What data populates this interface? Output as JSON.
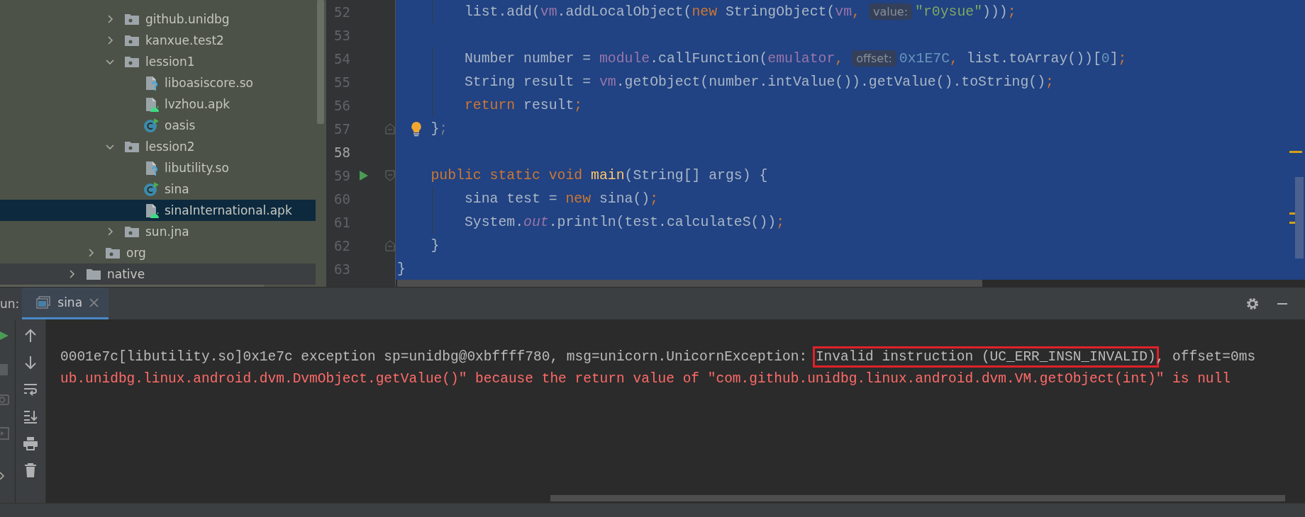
{
  "tree": {
    "items": [
      {
        "children": [
          {
            "children": [
              {
                "label": "github.unidbg",
                "kind": "package",
                "expanded": false,
                "selected": false
              },
              {
                "label": "kanxue.test2",
                "kind": "package",
                "expanded": false,
                "selected": false
              },
              {
                "label": "lession1",
                "kind": "package",
                "expanded": true,
                "selected": false,
                "children": [
                  {
                    "label": "liboasiscore.so",
                    "kind": "so",
                    "selected": false
                  },
                  {
                    "label": "lvzhou.apk",
                    "kind": "apk",
                    "selected": false
                  },
                  {
                    "label": "oasis",
                    "kind": "class",
                    "selected": false
                  }
                ]
              },
              {
                "label": "lession2",
                "kind": "package",
                "expanded": true,
                "selected": false,
                "children": [
                  {
                    "label": "libutility.so",
                    "kind": "so",
                    "selected": false
                  },
                  {
                    "label": "sina",
                    "kind": "class",
                    "selected": false
                  },
                  {
                    "label": "sinaInternational.apk",
                    "kind": "apk",
                    "selected": true
                  }
                ]
              },
              {
                "label": "sun.jna",
                "kind": "package",
                "expanded": false,
                "selected": false
              }
            ]
          },
          {
            "label": "org",
            "kind": "package",
            "expanded": false,
            "selected": false
          }
        ]
      },
      {
        "label": "native",
        "kind": "folder",
        "expanded": false,
        "selected": false
      }
    ]
  },
  "editor": {
    "lines": [
      {
        "number": "52",
        "current": false,
        "run": false,
        "bulb": false,
        "tokens": [
          {
            "text": "        list.add(",
            "kind": "plain"
          },
          {
            "text": "vm",
            "kind": "field"
          },
          {
            "text": ".addLocalObject(",
            "kind": "plain"
          },
          {
            "text": "new",
            "kind": "kw"
          },
          {
            "text": " StringObject(",
            "kind": "plain"
          },
          {
            "text": "vm",
            "kind": "field"
          },
          {
            "text": ",",
            "kind": "punct"
          },
          {
            "text": "value:",
            "kind": "hint"
          },
          {
            "text": "\"r0ysue\"",
            "kind": "str"
          },
          {
            "text": ")))",
            "kind": "plain"
          },
          {
            "text": ";",
            "kind": "punct"
          }
        ]
      },
      {
        "number": "53",
        "current": false,
        "run": false,
        "bulb": false
      },
      {
        "number": "54",
        "current": false,
        "run": false,
        "bulb": false,
        "tokens": [
          {
            "text": "        Number number = ",
            "kind": "plain"
          },
          {
            "text": "module",
            "kind": "field"
          },
          {
            "text": ".callFunction(",
            "kind": "plain"
          },
          {
            "text": "emulator",
            "kind": "field"
          },
          {
            "text": ",",
            "kind": "punct"
          },
          {
            "text": "offset:",
            "kind": "hint"
          },
          {
            "text": "0x1E7C",
            "kind": "num"
          },
          {
            "text": ",",
            "kind": "punct"
          },
          {
            "text": " list.toArray())[",
            "kind": "plain"
          },
          {
            "text": "0",
            "kind": "num"
          },
          {
            "text": "]",
            "kind": "plain"
          },
          {
            "text": ";",
            "kind": "punct"
          }
        ]
      },
      {
        "number": "55",
        "current": false,
        "run": false,
        "bulb": false,
        "tokens": [
          {
            "text": "        String result = ",
            "kind": "plain"
          },
          {
            "text": "vm",
            "kind": "field"
          },
          {
            "text": ".getObject(number.intValue()).getValue().toString()",
            "kind": "plain"
          },
          {
            "text": ";",
            "kind": "punct"
          }
        ]
      },
      {
        "number": "56",
        "current": false,
        "run": false,
        "bulb": false,
        "tokens": [
          {
            "text": "        return",
            "kind": "kw"
          },
          {
            "text": " result",
            "kind": "plain"
          },
          {
            "text": ";",
            "kind": "punct"
          }
        ]
      },
      {
        "number": "57",
        "current": false,
        "run": false,
        "bulb": true,
        "fold_start": false,
        "fold_end": true,
        "tokens": [
          {
            "text": "    }",
            "kind": "plain"
          },
          {
            "text": ";",
            "kind": "dim"
          }
        ]
      },
      {
        "number": "58",
        "current": true,
        "run": false,
        "bulb": false
      },
      {
        "number": "59",
        "current": false,
        "run": true,
        "bulb": false,
        "fold_start": true,
        "fold_end": false,
        "tokens": [
          {
            "text": "    public static void",
            "kind": "kw"
          },
          {
            "text": " main",
            "kind": "method"
          },
          {
            "text": "(String[] args) {",
            "kind": "plain"
          }
        ]
      },
      {
        "number": "60",
        "current": false,
        "run": false,
        "bulb": false,
        "tokens": [
          {
            "text": "        sina test = ",
            "kind": "plain"
          },
          {
            "text": "new",
            "kind": "kw"
          },
          {
            "text": " sina()",
            "kind": "plain"
          },
          {
            "text": ";",
            "kind": "punct"
          }
        ]
      },
      {
        "number": "61",
        "current": false,
        "run": false,
        "bulb": false,
        "tokens": [
          {
            "text": "        System.",
            "kind": "plain"
          },
          {
            "text": "out",
            "kind": "static"
          },
          {
            "text": ".println(test.calculateS())",
            "kind": "plain"
          },
          {
            "text": ";",
            "kind": "punct"
          }
        ]
      },
      {
        "number": "62",
        "current": false,
        "run": false,
        "bulb": false,
        "fold_start": false,
        "fold_end": true,
        "tokens": [
          {
            "text": "    }",
            "kind": "plain"
          }
        ]
      },
      {
        "number": "63",
        "current": false,
        "run": false,
        "bulb": false,
        "tokens": [
          {
            "text": "}",
            "kind": "plain"
          }
        ]
      }
    ]
  },
  "run_panel": {
    "label": "un:",
    "tabs": [
      {
        "label": "sina",
        "selected": true
      }
    ],
    "console": [
      {
        "kind": "output",
        "segments": [
          {
            "text": "0001e7c[libutility.so]0x1e7c exception sp=unidbg@0xbffff780, msg=unicorn.UnicornException: ",
            "boxed": false
          },
          {
            "text": "Invalid instruction (UC_ERR_INSN_INVALID)",
            "boxed": true
          },
          {
            "text": ", offset=0ms",
            "boxed": false
          }
        ]
      },
      {
        "kind": "error",
        "segments": [
          {
            "text": "ub.unidbg.linux.android.dvm.DvmObject.getValue()\" because the return value of \"com.github.unidbg.linux.android.dvm.VM.getObject(int)\" is null",
            "boxed": false
          }
        ]
      }
    ]
  }
}
